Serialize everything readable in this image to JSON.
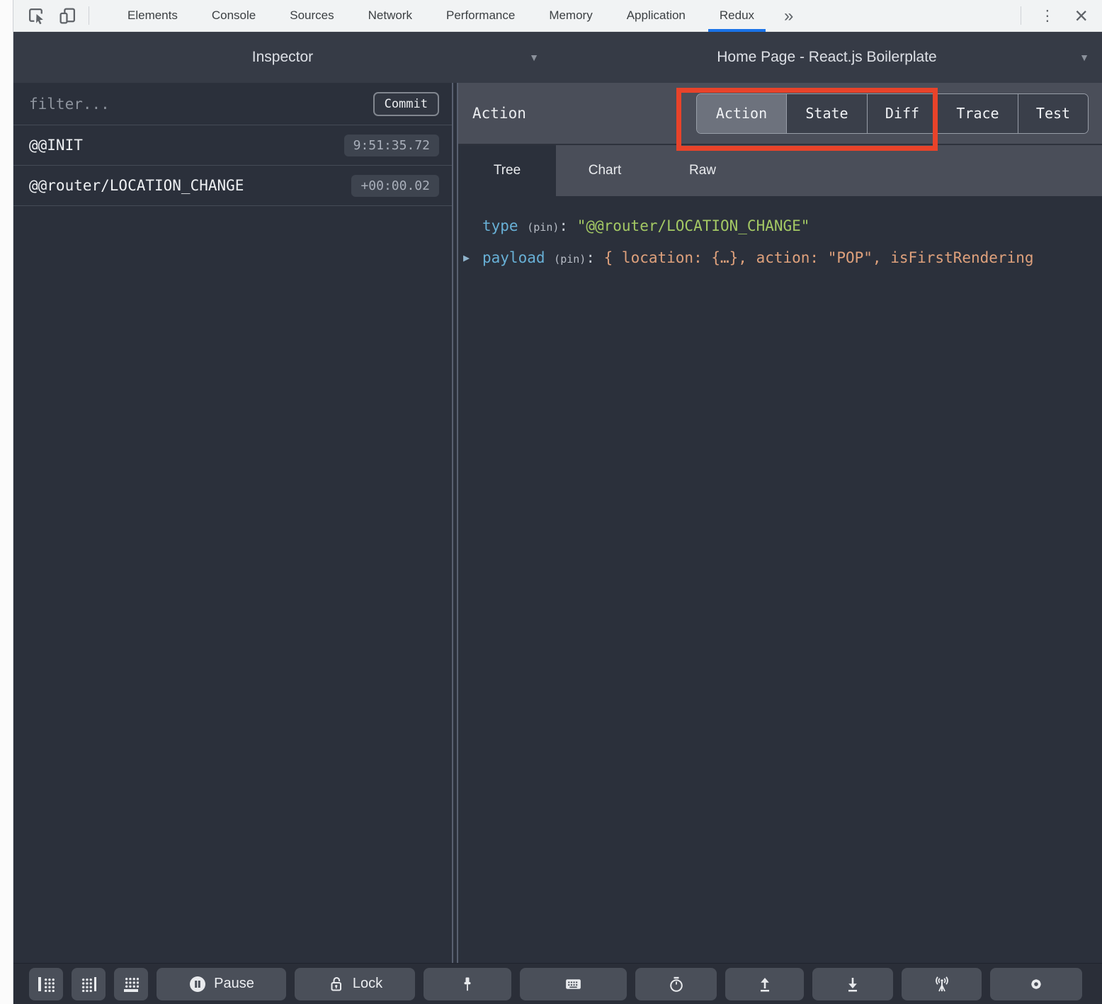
{
  "devtools": {
    "tabs": [
      "Elements",
      "Console",
      "Sources",
      "Network",
      "Performance",
      "Memory",
      "Application",
      "Redux"
    ],
    "active_tab": "Redux",
    "overflow_chevron": "»",
    "kebab": "⋮",
    "close": "×",
    "accent_blue": "#1a73e8"
  },
  "selector_header": {
    "left_title": "Inspector",
    "right_title": "Home Page - React.js Boilerplate",
    "caret": "▼"
  },
  "inspector": {
    "filter_placeholder": "filter...",
    "commit_label": "Commit",
    "actions": [
      {
        "name": "@@INIT",
        "time": "9:51:35.72"
      },
      {
        "name": "@@router/LOCATION_CHANGE",
        "time": "+00:00.02"
      }
    ]
  },
  "right_panel": {
    "title": "Action",
    "mode_tabs": [
      {
        "label": "Action"
      },
      {
        "label": "State"
      },
      {
        "label": "Diff"
      },
      {
        "label": "Trace"
      },
      {
        "label": "Test"
      }
    ],
    "selected_mode": "Action",
    "view_tabs": [
      {
        "label": "Tree"
      },
      {
        "label": "Chart"
      },
      {
        "label": "Raw"
      }
    ],
    "selected_view": "Tree",
    "tree": {
      "expand_arrow": "▶",
      "type_key": "type",
      "pin_label": "(pin)",
      "colon": ":",
      "type_value": "\"@@router/LOCATION_CHANGE\"",
      "payload_key": "payload",
      "payload_preview": "{ location: {…}, action: \"POP\", isFirstRendering"
    }
  },
  "toolbar": {
    "pause_label": "Pause",
    "lock_label": "Lock"
  },
  "annotation": {
    "color": "#e8432a"
  }
}
